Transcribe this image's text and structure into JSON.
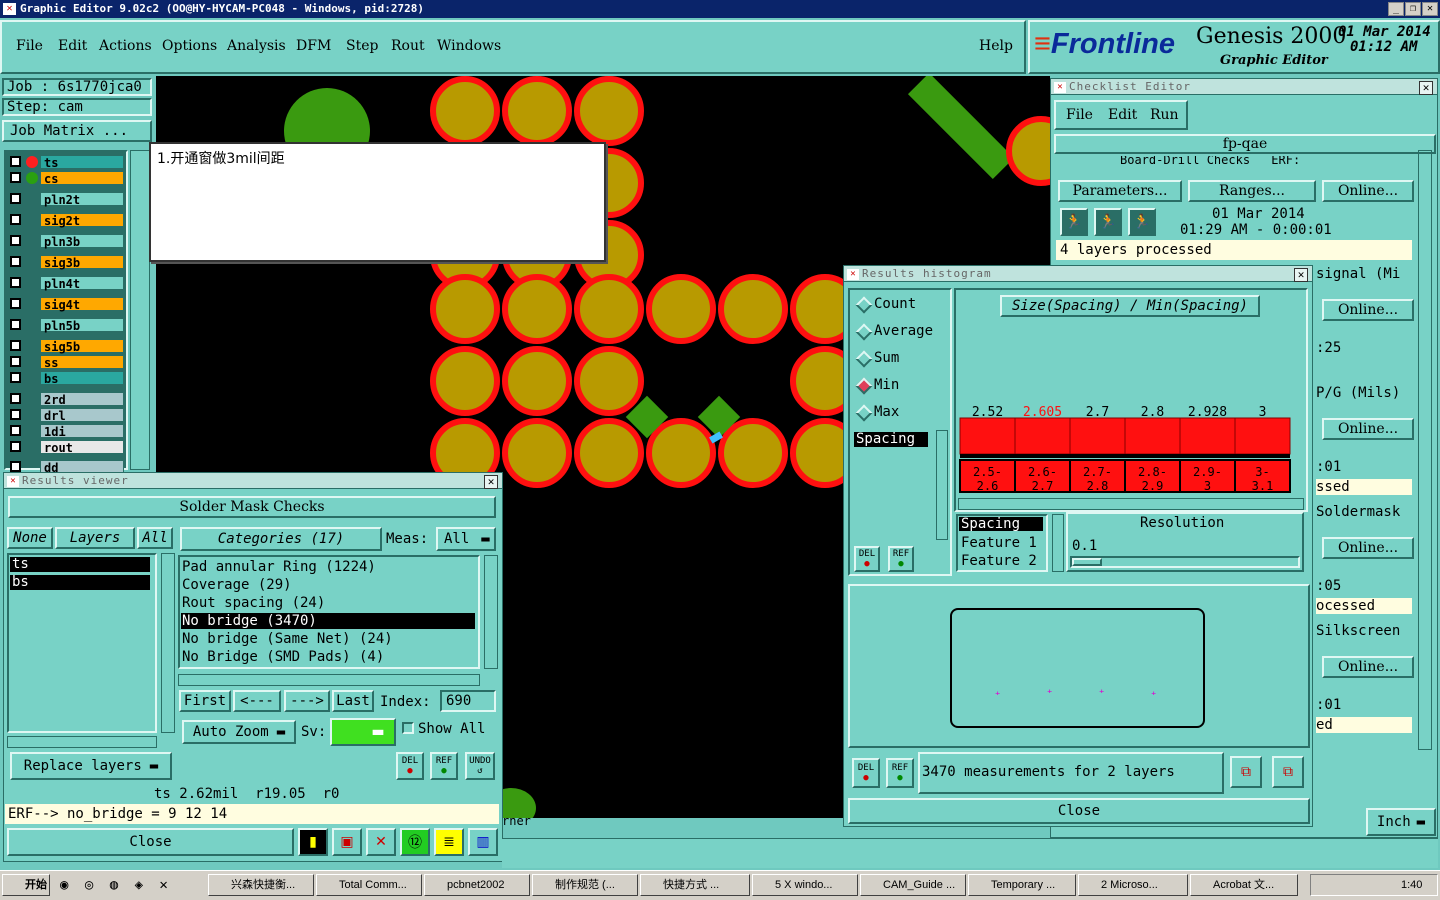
{
  "titlebar": {
    "title": "Graphic Editor 9.02c2  (OO@HY-HYCAM-PC048 - Windows, pid:2728)"
  },
  "menu": {
    "items": [
      "File",
      "Edit",
      "Actions",
      "Options",
      "Analysis",
      "DFM",
      "Step",
      "Rout",
      "Windows"
    ],
    "help": "Help"
  },
  "brand": {
    "logo": "Frontline",
    "product": "Genesis 2000",
    "subtitle": "Graphic Editor",
    "date": "01 Mar 2014",
    "time": "01:12 AM"
  },
  "job": {
    "job": "Job :  6s1770jca0",
    "step": "Step:  cam",
    "matrix_btn": "Job Matrix ..."
  },
  "layers": [
    {
      "name": "ts",
      "color": "#2aa8a0"
    },
    {
      "name": "cs",
      "color": "#ffa800"
    },
    {
      "name": "pln2t",
      "color": "#78d2c6"
    },
    {
      "name": "sig2t",
      "color": "#ffa800"
    },
    {
      "name": "pln3b",
      "color": "#78d2c6"
    },
    {
      "name": "sig3b",
      "color": "#ffa800"
    },
    {
      "name": "pln4t",
      "color": "#78d2c6"
    },
    {
      "name": "sig4t",
      "color": "#ffa800"
    },
    {
      "name": "pln5b",
      "color": "#78d2c6"
    },
    {
      "name": "sig5b",
      "color": "#ffa800"
    },
    {
      "name": "ss",
      "color": "#ffa800"
    },
    {
      "name": "bs",
      "color": "#2aa8a0"
    },
    {
      "name": "2rd",
      "color": "#a8c8cc"
    },
    {
      "name": "drl",
      "color": "#a8c8cc"
    },
    {
      "name": "1di",
      "color": "#a8c8cc"
    },
    {
      "name": "rout",
      "color": "#e8e8e8"
    },
    {
      "name": "dd",
      "color": "#a8c8cc"
    }
  ],
  "note": {
    "text": "1.开通窗做3mil间距"
  },
  "results_viewer": {
    "title": "Results viewer",
    "header": "Solder Mask Checks",
    "none": "None",
    "layers_tab": "Layers",
    "all": "All",
    "layer_list": [
      "ts",
      "bs"
    ],
    "categories_label": "Categories (17)",
    "meas_label": "Meas:",
    "meas_value": "All",
    "categories": [
      "Pad annular Ring (1224)",
      "Coverage (29)",
      "Rout spacing (24)",
      "No bridge (3470)",
      "No bridge (Same Net) (24)",
      "No Bridge (SMD Pads) (4)"
    ],
    "selected_index": 3,
    "first": "First",
    "prev": "<---",
    "next": "--->",
    "last": "Last",
    "index_label": "Index:",
    "index_value": "690",
    "auto_zoom": "Auto Zoom",
    "sv_label": "Sv:",
    "show_all": "Show All",
    "replace_layers": "Replace layers",
    "del": "DEL",
    "ref": "REF",
    "undo": "UNDO",
    "status": "ts 2.62mil  r19.05  r0",
    "erf": "ERF--> no_bridge = 9 12 14",
    "close": "Close"
  },
  "checklist": {
    "title": "Checklist Editor",
    "menu": [
      "File",
      "Edit",
      "Run"
    ],
    "name": "fp-qae",
    "row_label": "Board-Drill Checks",
    "erf": "ERF:",
    "params": "Parameters...",
    "ranges": "Ranges...",
    "online": "Online...",
    "date": "01 Mar 2014",
    "time": "01:29 AM - 0:00:01",
    "processed": "4 layers processed",
    "side_texts": [
      "signal (Mi",
      ":25",
      "P/G (Mils)",
      ":01",
      "ssed",
      "Soldermask",
      ":05",
      "ocessed",
      "Silkscreen",
      ":01",
      "ed"
    ],
    "inch": "Inch"
  },
  "histogram": {
    "title": "Results histogram",
    "modes": [
      "Count",
      "Average",
      "Sum",
      "Min",
      "Max"
    ],
    "selected_mode": "Min",
    "list": [
      "Spacing"
    ],
    "chart_title": "Size(Spacing) / Min(Spacing)",
    "del": "DEL",
    "ref": "REF",
    "measures": [
      "Spacing",
      "Feature 1",
      "Feature 2"
    ],
    "resolution_label": "Resolution",
    "resolution_value": "0.1",
    "summary": "3470 measurements for 2 layers",
    "close": "Close"
  },
  "chart_data": {
    "type": "bar",
    "title": "Size(Spacing) / Min(Spacing)",
    "categories": [
      "2.5-2.6",
      "2.6-2.7",
      "2.7-2.8",
      "2.8-2.9",
      "2.9-3",
      "3-3.1"
    ],
    "values": [
      2.52,
      2.605,
      2.7,
      2.8,
      2.928,
      3
    ],
    "value_labels": [
      "2.52",
      "2.605",
      "2.7",
      "2.8",
      "2.928",
      "3"
    ],
    "highlight_index": 1,
    "colors": {
      "bar": "#ff1010",
      "highlight_label": "#ff1010"
    }
  },
  "bottom": {
    "corner_text": "rner"
  },
  "taskbar": {
    "start": "开始",
    "items": [
      "兴森快捷衡...",
      "Total Comm...",
      "pcbnet2002",
      "制作规范 (...",
      "快捷方式 ...",
      "5 X windo...",
      "CAM_Guide ...",
      "Temporary ...",
      "2 Microso...",
      "Acrobat 文..."
    ],
    "clock": "1:40"
  }
}
